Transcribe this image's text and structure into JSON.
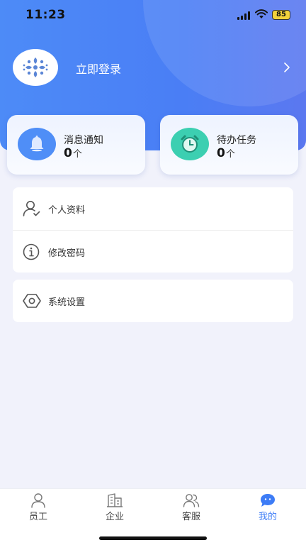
{
  "status_bar": {
    "time": "11:23",
    "battery": "85"
  },
  "header": {
    "login_label": "立即登录"
  },
  "cards": [
    {
      "title": "消息通知",
      "count": "0",
      "unit": "个"
    },
    {
      "title": "待办任务",
      "count": "0",
      "unit": "个"
    }
  ],
  "menu": {
    "group1": [
      {
        "label": "个人资料",
        "icon": "user-check-icon"
      },
      {
        "label": "修改密码",
        "icon": "info-icon"
      }
    ],
    "group2": [
      {
        "label": "系统设置",
        "icon": "hexagon-settings-icon"
      }
    ]
  },
  "tabs": [
    {
      "label": "员工",
      "icon": "person-icon",
      "active": false
    },
    {
      "label": "企业",
      "icon": "building-icon",
      "active": false
    },
    {
      "label": "客服",
      "icon": "people-icon",
      "active": false
    },
    {
      "label": "我的",
      "icon": "chat-bubble-icon",
      "active": true
    }
  ],
  "colors": {
    "primary": "#3d7cf6",
    "bell_circle": "#4f8ef7",
    "clock_circle": "#3ccfb1"
  }
}
